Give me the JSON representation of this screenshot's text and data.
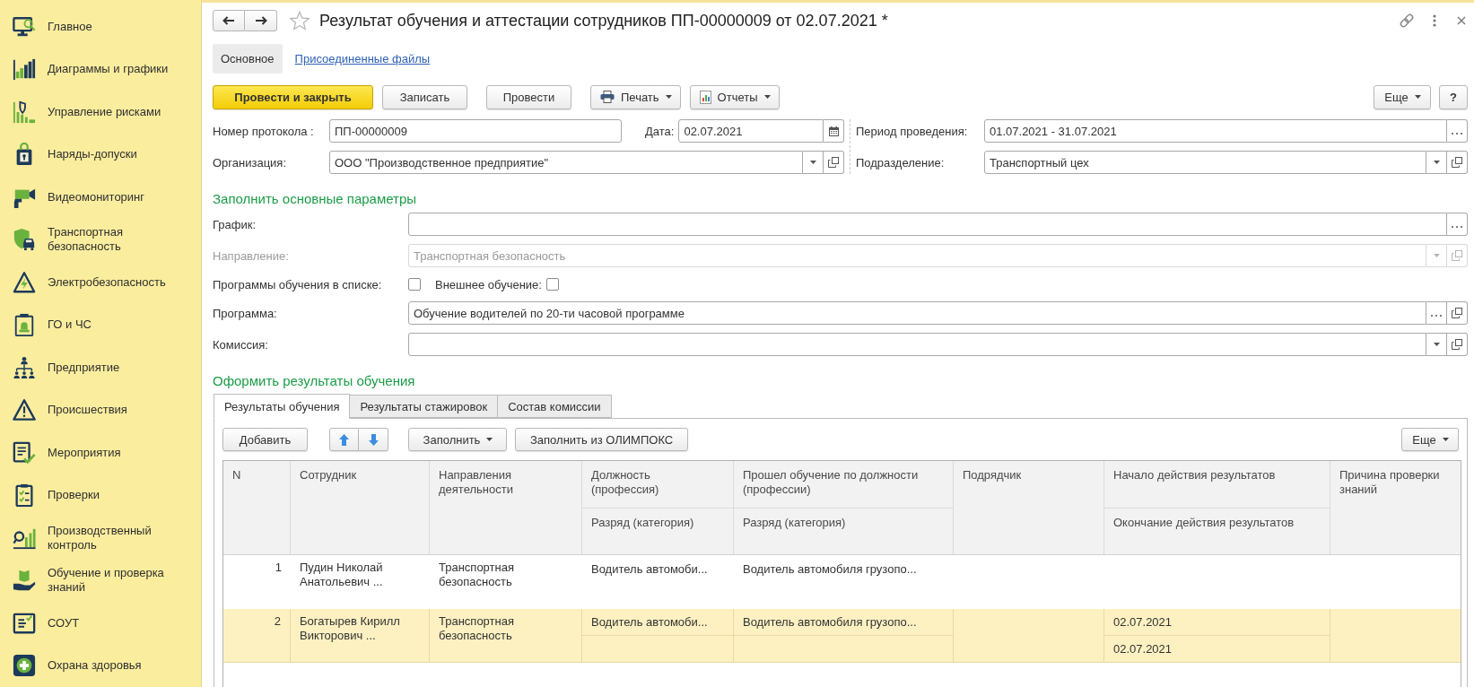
{
  "sidebar": {
    "items": [
      "Главное",
      "Диаграммы и графики",
      "Управление рисками",
      "Наряды-допуски",
      "Видеомониторинг",
      "Транспортная безопасность",
      "Электробезопасность",
      "ГО и ЧС",
      "Предприятие",
      "Происшествия",
      "Мероприятия",
      "Проверки",
      "Производственный контроль",
      "Обучение и проверка знаний",
      "СОУТ",
      "Охрана здоровья"
    ]
  },
  "window": {
    "title": "Результат обучения и аттестации сотрудников ПП-00000009 от 02.07.2021 *"
  },
  "form_tabs": [
    {
      "label": "Основное",
      "selected": true
    },
    {
      "label": "Присоединенные файлы",
      "selected": false
    }
  ],
  "command_bar": {
    "post_and_close": "Провести и закрыть",
    "buttons": [
      "Записать",
      "Провести"
    ],
    "print": "Печать",
    "reports": "Отчеты",
    "more": "Еще",
    "help": "?"
  },
  "header": {
    "left": [
      {
        "fields": [
          {
            "label": "Номер протокола :",
            "value": "ПП-00000009",
            "kind": "text"
          },
          {
            "label": "Дата:",
            "value": "02.07.2021",
            "kind": "date"
          }
        ]
      },
      {
        "fields": [
          {
            "label": "Организация:",
            "value": "ООО \"Производственное предприятие\"",
            "kind": "dropdown-open"
          }
        ]
      }
    ],
    "right": [
      {
        "fields": [
          {
            "label": "Период проведения:",
            "value": "01.07.2021 - 31.07.2021",
            "kind": "select"
          }
        ]
      },
      {
        "fields": [
          {
            "label": "Подразделение:",
            "value": "Транспортный цех",
            "kind": "dropdown-open"
          }
        ]
      }
    ]
  },
  "main_params": {
    "title": "Заполнить основные параметры",
    "rows": [
      {
        "kind": "select",
        "label": "График:",
        "disabled": false
      },
      {
        "kind": "dropdown-open",
        "label": "Направление:",
        "value": "Транспортная безопасность",
        "disabled": true
      },
      {
        "kind": "checkboxes",
        "items": [
          {
            "label": "Программы обучения в списке:",
            "checked": false
          },
          {
            "label": "Внешнее обучение:",
            "checked": false
          }
        ]
      },
      {
        "kind": "select-open",
        "label": "Программа:",
        "value": "Обучение водителей по 20-ти часовой программе",
        "disabled": false
      },
      {
        "kind": "dropdown-open",
        "label": "Комиссия:",
        "disabled": false
      }
    ]
  },
  "results": {
    "title": "Оформить результаты обучения",
    "tabs": [
      {
        "label": "Результаты обучения",
        "selected": true
      },
      {
        "label": "Результаты стажировок",
        "selected": false
      },
      {
        "label": "Состав комиссии",
        "selected": false
      }
    ],
    "toolbar": {
      "add": "Добавить",
      "fill": "Заполнить",
      "fill_from": "Заполнить из ОЛИМПОКС",
      "more": "Еще"
    },
    "table": {
      "columns": [
        {
          "label": "N"
        },
        {
          "label": "Сотрудник"
        },
        {
          "label": "Направления деятельности"
        },
        {
          "label": "Должность (профессия)",
          "sub_label": "Разряд (категория)"
        },
        {
          "label": "Прошел обучение по должности (профессии)",
          "sub_label": "Разряд (категория)"
        },
        {
          "label": "Подрядчик"
        },
        {
          "label": "Начало действия результатов",
          "sub_label": "Окончание действия результатов"
        },
        {
          "label": "Причина проверки знаний"
        }
      ],
      "rows": [
        {
          "n": "1",
          "employee": "Пудин Николай Анатольевич ...",
          "direction": "Транспортная безопасность",
          "position": "Водитель автомоби...",
          "trained_position": "Водитель автомобиля грузопо...",
          "selected": false
        },
        {
          "n": "2",
          "employee": "Богатырев Кирилл Викторович ...",
          "direction": "Транспортная безопасность",
          "position": "Водитель автомоби...",
          "trained_position": "Водитель автомобиля грузопо...",
          "start_date": "02.07.2021",
          "end_date": "02.07.2021",
          "selected": true
        }
      ]
    }
  }
}
